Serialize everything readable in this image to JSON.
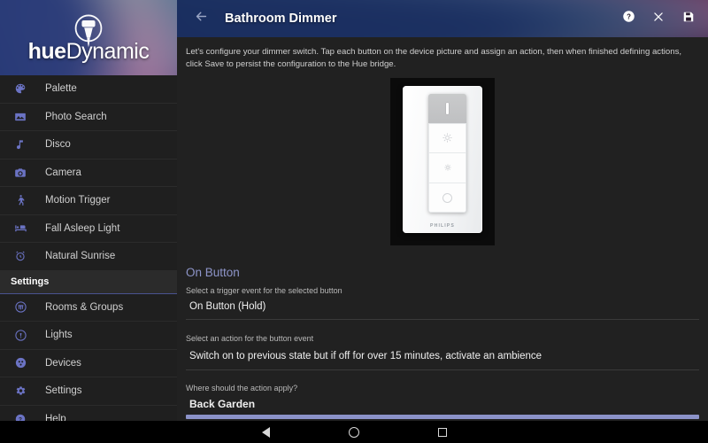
{
  "app": {
    "logo_prefix": "hue",
    "logo_suffix": "Dynamic",
    "logo_icon": "light-bulb-icon"
  },
  "sidebar": {
    "items": [
      {
        "label": "Palette",
        "icon": "palette-icon"
      },
      {
        "label": "Photo Search",
        "icon": "photo-icon"
      },
      {
        "label": "Disco",
        "icon": "music-note-icon"
      },
      {
        "label": "Camera",
        "icon": "camera-icon"
      },
      {
        "label": "Motion Trigger",
        "icon": "walking-person-icon"
      },
      {
        "label": "Fall Asleep Light",
        "icon": "bed-icon"
      },
      {
        "label": "Natural Sunrise",
        "icon": "alarm-clock-icon"
      }
    ],
    "section_header": "Settings",
    "settings_items": [
      {
        "label": "Rooms & Groups",
        "icon": "rooms-icon"
      },
      {
        "label": "Lights",
        "icon": "bulb-circle-icon"
      },
      {
        "label": "Devices",
        "icon": "devices-icon"
      },
      {
        "label": "Settings",
        "icon": "gear-icon"
      },
      {
        "label": "Help",
        "icon": "help-circle-icon"
      }
    ]
  },
  "header": {
    "title": "Bathroom Dimmer",
    "back_icon": "arrow-left-icon",
    "actions": [
      {
        "name": "help-button",
        "icon": "help-circle-icon"
      },
      {
        "name": "close-button",
        "icon": "close-x-icon"
      },
      {
        "name": "save-button",
        "icon": "save-floppy-icon"
      }
    ]
  },
  "main": {
    "intro": "Let's configure your dimmer switch. Tap each button on the device picture and assign an action, then when finished defining actions, click Save to persist the configuration to the Hue bridge.",
    "device": {
      "brand": "PHILIPS",
      "buttons": [
        {
          "name": "on-button",
          "glyph": "I",
          "selected": true
        },
        {
          "name": "brightness-up-button",
          "glyph": "brightness-high-icon",
          "selected": false
        },
        {
          "name": "brightness-down-button",
          "glyph": "brightness-low-icon",
          "selected": false
        },
        {
          "name": "off-button",
          "glyph": "O",
          "selected": false
        }
      ]
    },
    "section_title": "On Button",
    "fields": [
      {
        "label": "Select a trigger event for the selected button",
        "value": "On Button (Hold)"
      },
      {
        "label": "Select an action for the button event",
        "value": "Switch on to previous state but if off for over 15 minutes, activate an ambience"
      },
      {
        "label": "Where should the action apply?",
        "value": "Back Garden"
      }
    ]
  },
  "navbar": {
    "back": "back-triangle-icon",
    "home": "home-circle-icon",
    "recents": "recents-square-icon"
  },
  "colors": {
    "accent": "#8b92c8",
    "sidebar_icon": "#6b73c4",
    "content_bg": "#212121",
    "sidebar_bg": "#1f1f1f"
  }
}
